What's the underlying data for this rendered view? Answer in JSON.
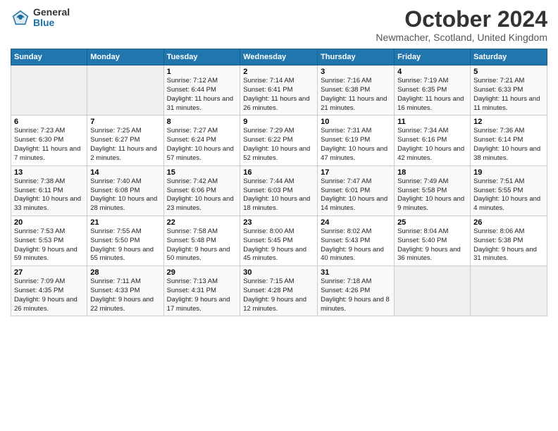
{
  "logo": {
    "general": "General",
    "blue": "Blue"
  },
  "header": {
    "month": "October 2024",
    "location": "Newmacher, Scotland, United Kingdom"
  },
  "days_of_week": [
    "Sunday",
    "Monday",
    "Tuesday",
    "Wednesday",
    "Thursday",
    "Friday",
    "Saturday"
  ],
  "weeks": [
    [
      {
        "day": "",
        "info": ""
      },
      {
        "day": "",
        "info": ""
      },
      {
        "day": "1",
        "info": "Sunrise: 7:12 AM\nSunset: 6:44 PM\nDaylight: 11 hours and 31 minutes."
      },
      {
        "day": "2",
        "info": "Sunrise: 7:14 AM\nSunset: 6:41 PM\nDaylight: 11 hours and 26 minutes."
      },
      {
        "day": "3",
        "info": "Sunrise: 7:16 AM\nSunset: 6:38 PM\nDaylight: 11 hours and 21 minutes."
      },
      {
        "day": "4",
        "info": "Sunrise: 7:19 AM\nSunset: 6:35 PM\nDaylight: 11 hours and 16 minutes."
      },
      {
        "day": "5",
        "info": "Sunrise: 7:21 AM\nSunset: 6:33 PM\nDaylight: 11 hours and 11 minutes."
      }
    ],
    [
      {
        "day": "6",
        "info": "Sunrise: 7:23 AM\nSunset: 6:30 PM\nDaylight: 11 hours and 7 minutes."
      },
      {
        "day": "7",
        "info": "Sunrise: 7:25 AM\nSunset: 6:27 PM\nDaylight: 11 hours and 2 minutes."
      },
      {
        "day": "8",
        "info": "Sunrise: 7:27 AM\nSunset: 6:24 PM\nDaylight: 10 hours and 57 minutes."
      },
      {
        "day": "9",
        "info": "Sunrise: 7:29 AM\nSunset: 6:22 PM\nDaylight: 10 hours and 52 minutes."
      },
      {
        "day": "10",
        "info": "Sunrise: 7:31 AM\nSunset: 6:19 PM\nDaylight: 10 hours and 47 minutes."
      },
      {
        "day": "11",
        "info": "Sunrise: 7:34 AM\nSunset: 6:16 PM\nDaylight: 10 hours and 42 minutes."
      },
      {
        "day": "12",
        "info": "Sunrise: 7:36 AM\nSunset: 6:14 PM\nDaylight: 10 hours and 38 minutes."
      }
    ],
    [
      {
        "day": "13",
        "info": "Sunrise: 7:38 AM\nSunset: 6:11 PM\nDaylight: 10 hours and 33 minutes."
      },
      {
        "day": "14",
        "info": "Sunrise: 7:40 AM\nSunset: 6:08 PM\nDaylight: 10 hours and 28 minutes."
      },
      {
        "day": "15",
        "info": "Sunrise: 7:42 AM\nSunset: 6:06 PM\nDaylight: 10 hours and 23 minutes."
      },
      {
        "day": "16",
        "info": "Sunrise: 7:44 AM\nSunset: 6:03 PM\nDaylight: 10 hours and 18 minutes."
      },
      {
        "day": "17",
        "info": "Sunrise: 7:47 AM\nSunset: 6:01 PM\nDaylight: 10 hours and 14 minutes."
      },
      {
        "day": "18",
        "info": "Sunrise: 7:49 AM\nSunset: 5:58 PM\nDaylight: 10 hours and 9 minutes."
      },
      {
        "day": "19",
        "info": "Sunrise: 7:51 AM\nSunset: 5:55 PM\nDaylight: 10 hours and 4 minutes."
      }
    ],
    [
      {
        "day": "20",
        "info": "Sunrise: 7:53 AM\nSunset: 5:53 PM\nDaylight: 9 hours and 59 minutes."
      },
      {
        "day": "21",
        "info": "Sunrise: 7:55 AM\nSunset: 5:50 PM\nDaylight: 9 hours and 55 minutes."
      },
      {
        "day": "22",
        "info": "Sunrise: 7:58 AM\nSunset: 5:48 PM\nDaylight: 9 hours and 50 minutes."
      },
      {
        "day": "23",
        "info": "Sunrise: 8:00 AM\nSunset: 5:45 PM\nDaylight: 9 hours and 45 minutes."
      },
      {
        "day": "24",
        "info": "Sunrise: 8:02 AM\nSunset: 5:43 PM\nDaylight: 9 hours and 40 minutes."
      },
      {
        "day": "25",
        "info": "Sunrise: 8:04 AM\nSunset: 5:40 PM\nDaylight: 9 hours and 36 minutes."
      },
      {
        "day": "26",
        "info": "Sunrise: 8:06 AM\nSunset: 5:38 PM\nDaylight: 9 hours and 31 minutes."
      }
    ],
    [
      {
        "day": "27",
        "info": "Sunrise: 7:09 AM\nSunset: 4:35 PM\nDaylight: 9 hours and 26 minutes."
      },
      {
        "day": "28",
        "info": "Sunrise: 7:11 AM\nSunset: 4:33 PM\nDaylight: 9 hours and 22 minutes."
      },
      {
        "day": "29",
        "info": "Sunrise: 7:13 AM\nSunset: 4:31 PM\nDaylight: 9 hours and 17 minutes."
      },
      {
        "day": "30",
        "info": "Sunrise: 7:15 AM\nSunset: 4:28 PM\nDaylight: 9 hours and 12 minutes."
      },
      {
        "day": "31",
        "info": "Sunrise: 7:18 AM\nSunset: 4:26 PM\nDaylight: 9 hours and 8 minutes."
      },
      {
        "day": "",
        "info": ""
      },
      {
        "day": "",
        "info": ""
      }
    ]
  ]
}
